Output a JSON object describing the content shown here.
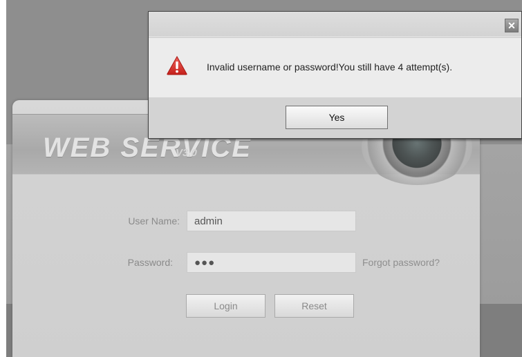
{
  "dialog": {
    "close_glyph": "✕",
    "icon": "warning-triangle-icon",
    "message": "Invalid username or password!You still have 4 attempt(s).",
    "yes_label": "Yes"
  },
  "login": {
    "banner_title": "WEB  SERVICE",
    "banner_version": "V3.0",
    "username_label": "User Name:",
    "username_value": "admin",
    "password_label": "Password:",
    "password_value": "●●●",
    "forgot_label": "Forgot password?",
    "login_label": "Login",
    "reset_label": "Reset"
  },
  "colors": {
    "warning": "#d8322a",
    "overlay": "#8e8e8e"
  }
}
